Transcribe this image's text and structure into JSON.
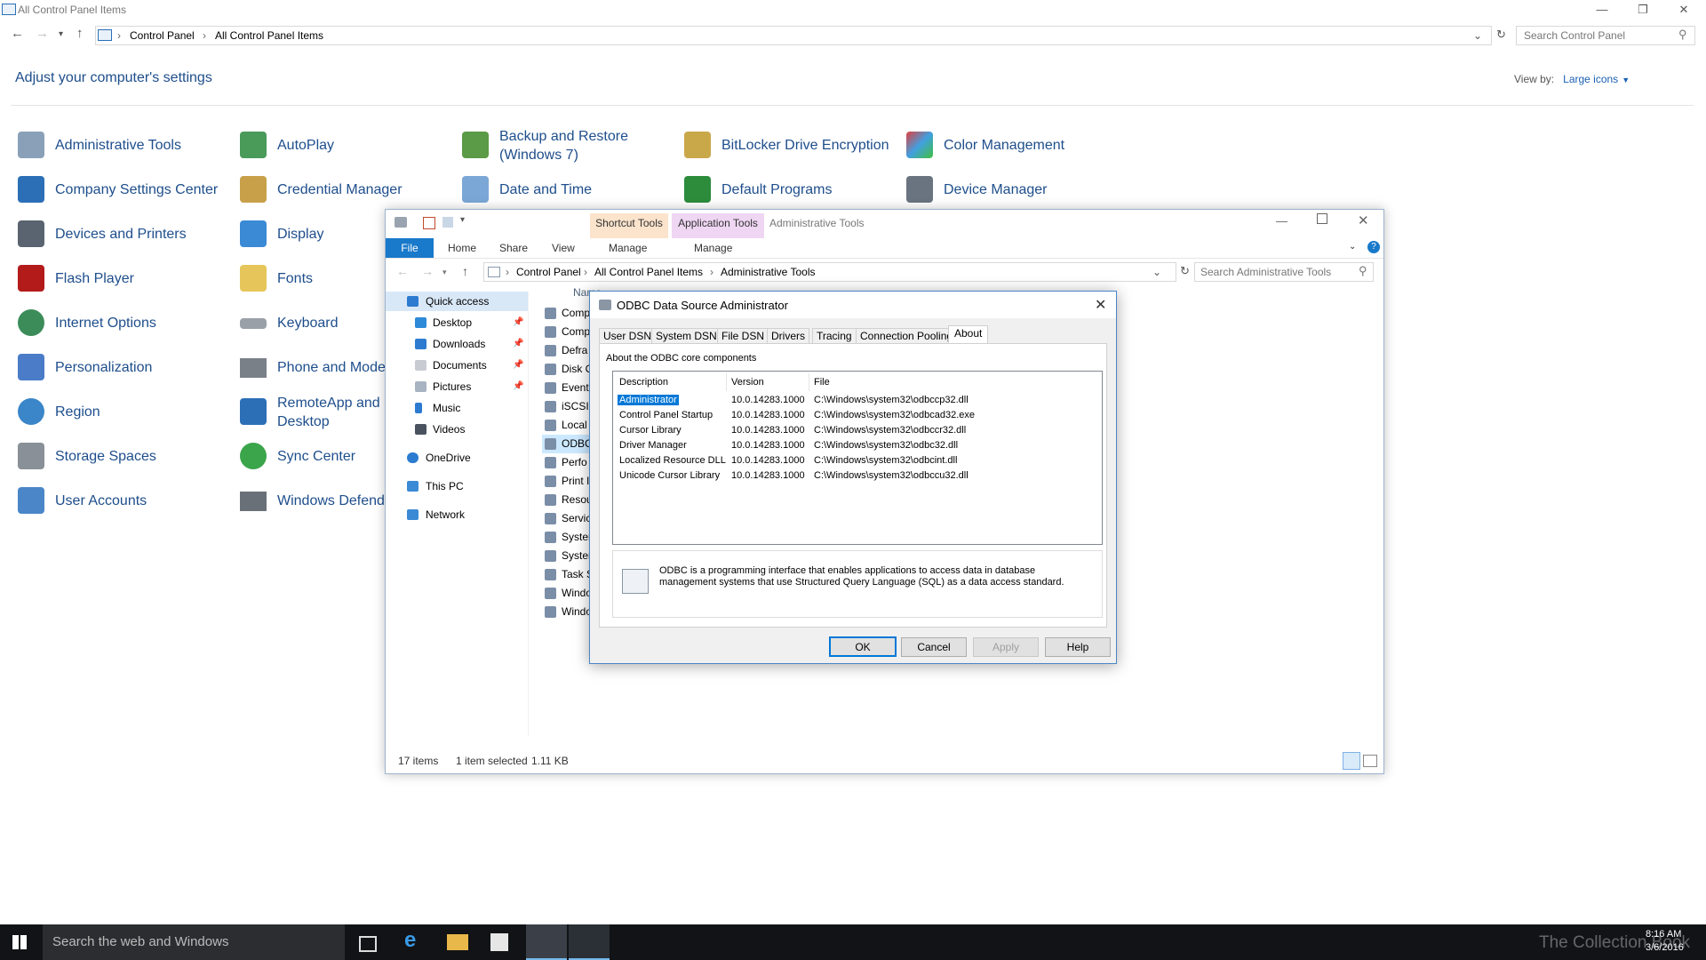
{
  "cp": {
    "title": "All Control Panel Items",
    "breadcrumb": [
      "Control Panel",
      "All Control Panel Items"
    ],
    "search_placeholder": "Search Control Panel",
    "heading": "Adjust your computer's settings",
    "view_by_label": "View by:",
    "view_by_value": "Large icons",
    "items": [
      {
        "label": "Administrative Tools",
        "icon": "administrative-tools-icon"
      },
      {
        "label": "AutoPlay",
        "icon": "autoplay-icon"
      },
      {
        "label": "Backup and Restore (Windows 7)",
        "icon": "backup-restore-icon"
      },
      {
        "label": "BitLocker Drive Encryption",
        "icon": "bitlocker-icon"
      },
      {
        "label": "Color Management",
        "icon": "color-management-icon"
      },
      {
        "label": "Company Settings Center",
        "icon": "company-settings-icon"
      },
      {
        "label": "Credential Manager",
        "icon": "credential-manager-icon"
      },
      {
        "label": "Date and Time",
        "icon": "date-time-icon"
      },
      {
        "label": "Default Programs",
        "icon": "default-programs-icon"
      },
      {
        "label": "Device Manager",
        "icon": "device-manager-icon"
      },
      {
        "label": "Devices and Printers",
        "icon": "devices-printers-icon"
      },
      {
        "label": "Display",
        "icon": "display-icon"
      },
      {
        "label": "Flash Player",
        "icon": "flash-player-icon"
      },
      {
        "label": "Fonts",
        "icon": "fonts-icon"
      },
      {
        "label": "Internet Options",
        "icon": "internet-options-icon"
      },
      {
        "label": "Keyboard",
        "icon": "keyboard-icon"
      },
      {
        "label": "Personalization",
        "icon": "personalization-icon"
      },
      {
        "label": "Phone and Modem",
        "icon": "phone-modem-icon"
      },
      {
        "label": "Region",
        "icon": "region-icon"
      },
      {
        "label": "RemoteApp and Desktop Connections",
        "icon": "remoteapp-icon"
      },
      {
        "label": "Storage Spaces",
        "icon": "storage-spaces-icon"
      },
      {
        "label": "Sync Center",
        "icon": "sync-center-icon"
      },
      {
        "label": "User Accounts",
        "icon": "user-accounts-icon"
      },
      {
        "label": "Windows Defender",
        "icon": "windows-defender-icon"
      }
    ]
  },
  "explorer": {
    "title": "Administrative Tools",
    "context_tabs": [
      "Shortcut Tools",
      "Application Tools"
    ],
    "ribbon_tabs": [
      "File",
      "Home",
      "Share",
      "View",
      "Manage",
      "Manage"
    ],
    "breadcrumb": [
      "Control Panel",
      "All Control Panel Items",
      "Administrative Tools"
    ],
    "search_placeholder": "Search Administrative Tools",
    "nav": [
      {
        "label": "Quick access",
        "pinned": false
      },
      {
        "label": "Desktop",
        "pinned": true
      },
      {
        "label": "Downloads",
        "pinned": true
      },
      {
        "label": "Documents",
        "pinned": true
      },
      {
        "label": "Pictures",
        "pinned": true
      },
      {
        "label": "Music",
        "pinned": false
      },
      {
        "label": "Videos",
        "pinned": false
      },
      {
        "label": "OneDrive",
        "pinned": false
      },
      {
        "label": "This PC",
        "pinned": false
      },
      {
        "label": "Network",
        "pinned": false
      }
    ],
    "column_name": "Name",
    "files": [
      "Comp",
      "Comp",
      "Defra",
      "Disk C",
      "Event",
      "iSCSI I",
      "Local",
      "ODBC",
      "Perfo",
      "Print I",
      "Resou",
      "Servic",
      "Syster",
      "Syster",
      "Task S",
      "Windo",
      "Windo"
    ],
    "status_items": "17 items",
    "status_selected": "1 item selected",
    "status_size": "1.11 KB"
  },
  "odbc": {
    "title": "ODBC Data Source Administrator",
    "tabs": [
      "User DSN",
      "System DSN",
      "File DSN",
      "Drivers",
      "Tracing",
      "Connection Pooling",
      "About"
    ],
    "active_tab": "About",
    "group_label": "About the ODBC core components",
    "columns": [
      "Description",
      "Version",
      "File"
    ],
    "rows": [
      {
        "description": "Administrator",
        "version": "10.0.14283.1000",
        "file": "C:\\Windows\\system32\\odbccp32.dll"
      },
      {
        "description": "Control Panel Startup",
        "version": "10.0.14283.1000",
        "file": "C:\\Windows\\system32\\odbcad32.exe"
      },
      {
        "description": "Cursor Library",
        "version": "10.0.14283.1000",
        "file": "C:\\Windows\\system32\\odbccr32.dll"
      },
      {
        "description": "Driver Manager",
        "version": "10.0.14283.1000",
        "file": "C:\\Windows\\system32\\odbc32.dll"
      },
      {
        "description": "Localized Resource DLL",
        "version": "10.0.14283.1000",
        "file": "C:\\Windows\\system32\\odbcint.dll"
      },
      {
        "description": "Unicode Cursor Library",
        "version": "10.0.14283.1000",
        "file": "C:\\Windows\\system32\\odbccu32.dll"
      }
    ],
    "info_text": "ODBC is a programming interface that enables applications to access data in database management systems that use Structured Query Language (SQL) as a data access standard.",
    "buttons": {
      "ok": "OK",
      "cancel": "Cancel",
      "apply": "Apply",
      "help": "Help"
    }
  },
  "taskbar": {
    "search_placeholder": "Search the web and Windows",
    "time": "8:16 AM",
    "date": "3/6/2016",
    "watermark": "The Collection Book"
  }
}
